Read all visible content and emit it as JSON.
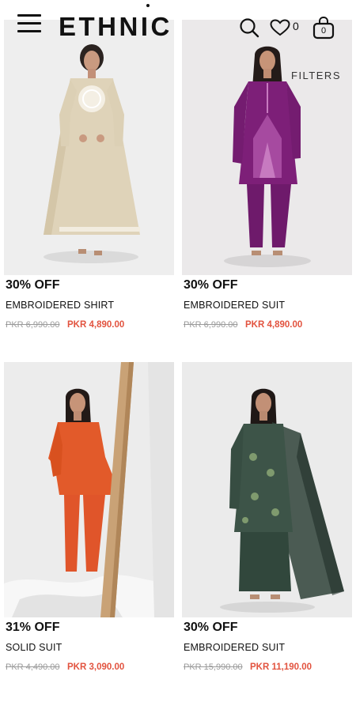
{
  "header": {
    "logo_text": "ETHNIC",
    "wishlist_count": "0",
    "bag_count": "0",
    "filters_label": "FILTERS"
  },
  "colors": {
    "sale_price": "#e2533f",
    "old_price": "#9a9a9a",
    "text": "#111111"
  },
  "icons": [
    "menu-icon",
    "search-icon",
    "heart-icon",
    "shopping-bag-icon"
  ],
  "products": [
    {
      "discount": "30% OFF",
      "name": "EMBROIDERED SHIRT",
      "old_price": "PKR 6,990.00",
      "new_price": "PKR 4,890.00",
      "image": "beige-embroidered-shirt"
    },
    {
      "discount": "30% OFF",
      "name": "EMBROIDERED SUIT",
      "old_price": "PKR 6,990.00",
      "new_price": "PKR 4,890.00",
      "image": "purple-embroidered-suit"
    },
    {
      "discount": "31% OFF",
      "name": "SOLID SUIT",
      "old_price": "PKR 4,490.00",
      "new_price": "PKR 3,090.00",
      "image": "orange-solid-suit"
    },
    {
      "discount": "30% OFF",
      "name": "EMBROIDERED SUIT",
      "old_price": "PKR 15,990.00",
      "new_price": "PKR 11,190.00",
      "image": "green-embroidered-suit"
    }
  ]
}
